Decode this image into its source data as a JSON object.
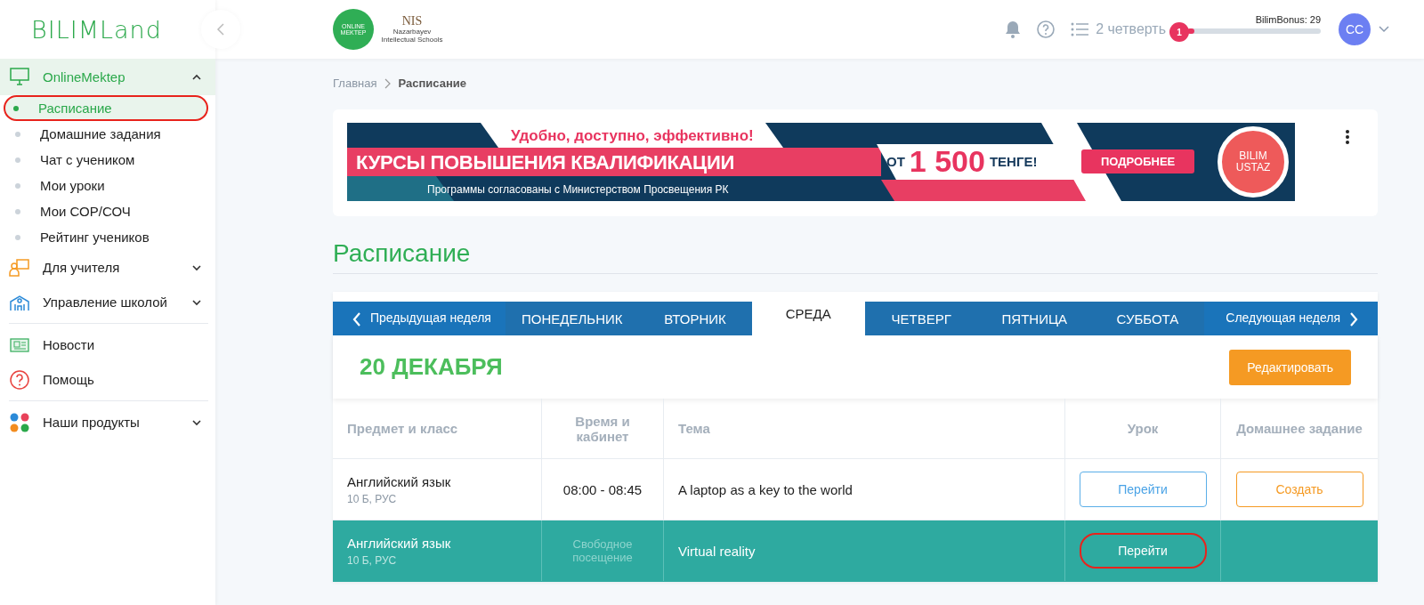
{
  "sidebar": {
    "logo": "BILIMLand",
    "sections": [
      [
        {
          "label": "OnlineMektep",
          "expanded": true,
          "children": [
            {
              "label": "Расписание",
              "selected": true,
              "annotated": true
            },
            {
              "label": "Домашние задания",
              "selected": false,
              "annotated": false
            },
            {
              "label": "Чат с учеником",
              "selected": false,
              "annotated": false
            },
            {
              "label": "Мои уроки",
              "selected": false,
              "annotated": false
            },
            {
              "label": "Мои СОР/СОЧ",
              "selected": false,
              "annotated": false
            },
            {
              "label": "Рейтинг учеников",
              "selected": false,
              "annotated": false
            }
          ]
        },
        {
          "label": "Для учителя",
          "expanded": false
        },
        {
          "label": "Управление школой",
          "expanded": false
        }
      ],
      [
        {
          "label": "Новости"
        },
        {
          "label": "Помощь"
        }
      ],
      [
        {
          "label": "Наши продукты",
          "expanded": false
        }
      ]
    ]
  },
  "header": {
    "partner_logos": [
      {
        "text": "ONLINE MEKTEP"
      },
      {
        "text": "NIS",
        "subtext": "Nazarbayev Intellectual Schools"
      }
    ],
    "quarter": "2 четверть",
    "bonus": {
      "label": "BilimBonus: 29",
      "badge": "1",
      "level": 0.05
    },
    "avatar": "CC"
  },
  "breadcrumbs": [
    {
      "label": "Главная",
      "current": false
    },
    {
      "label": "Расписание",
      "current": true
    }
  ],
  "banner": {
    "tagline": "Удобно, доступно, эффективно!",
    "headline": "КУРСЫ ПОВЫШЕНИЯ КВАЛИФИКАЦИИ",
    "price_prefix": "ОТ",
    "price": "1 500",
    "price_suffix": "ТЕНГЕ!",
    "note": "Программы согласованы с Министерством Просвещения РК",
    "cta": "ПОДРОБНЕЕ",
    "badge": "BILIM USTAZ"
  },
  "page_title": "Расписание",
  "schedule": {
    "prev": "Предыдущая неделя",
    "next": "Следующая неделя",
    "tabs": [
      {
        "label": "ПОНЕДЕЛЬНИК",
        "selected": false
      },
      {
        "label": "ВТОРНИК",
        "selected": false
      },
      {
        "label": "СРЕДА",
        "selected": true
      },
      {
        "label": "ЧЕТВЕРГ",
        "selected": false
      },
      {
        "label": "ПЯТНИЦА",
        "selected": false
      },
      {
        "label": "СУББОТА",
        "selected": false
      }
    ],
    "date": "20 ДЕКАБРЯ",
    "edit_button": "Редактировать",
    "columns": [
      "Предмет и класс",
      "Время и кабинет",
      "Тема",
      "Урок",
      "Домашнее задание"
    ],
    "rows": [
      {
        "subject": "Английский язык",
        "class": "10 Б, РУС",
        "time": "08:00 - 08:45",
        "topic": "A laptop as a key to the world",
        "lesson_button": "Перейти",
        "homework_button": "Создать",
        "selected": false,
        "annotated": false
      },
      {
        "subject": "Английский язык",
        "class": "10 Б, РУС",
        "time": "Свободное посещение",
        "topic": "Virtual reality",
        "lesson_button": "Перейти",
        "selected": true,
        "annotated": true
      }
    ]
  }
}
